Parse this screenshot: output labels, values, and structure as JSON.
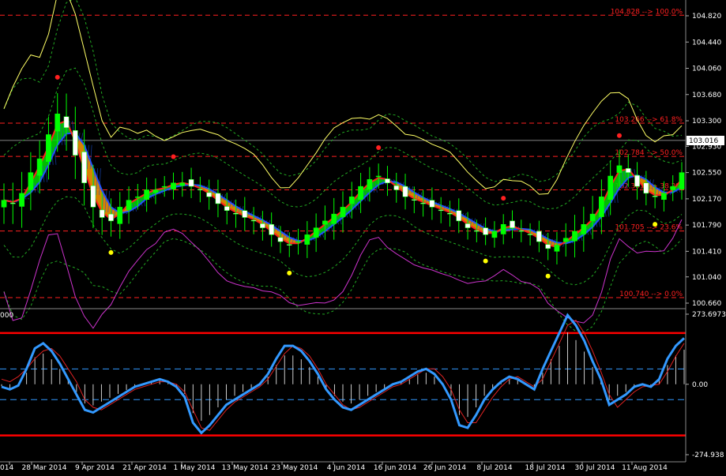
{
  "chart_data": [
    {
      "type": "candlestick",
      "ylim": [
        100.66,
        104.82
      ],
      "y_ticks": [
        "104.820",
        "104.440",
        "104.060",
        "103.680",
        "103.300",
        "102.930",
        "102.550",
        "102.170",
        "101.790",
        "101.410",
        "101.040",
        "100.660"
      ],
      "x_labels": [
        "014",
        "28 Mar 2014",
        "9 Apr 2014",
        "21 Apr 2014",
        "1 May 2014",
        "13 May 2014",
        "23 May 2014",
        "4 Jun 2014",
        "16 Jun 2014",
        "26 Jun 2014",
        "8 Jul 2014",
        "18 Jul 2014",
        "30 Jul 2014",
        "11 Aug 2014"
      ],
      "current_price": "103.016",
      "fib_levels": [
        {
          "value": 104.828,
          "label": "104.828 --> 100.0%"
        },
        {
          "value": 103.266,
          "label": "103.266 --> 61.8%"
        },
        {
          "value": 102.784,
          "label": "102.784 --> 50.0%"
        },
        {
          "value": 102.3,
          "label": "102.301 --> 38.2%"
        },
        {
          "value": 101.705,
          "label": "101.705 --> 23.6%"
        },
        {
          "value": 100.74,
          "label": "100.740 --> 0.0%"
        }
      ],
      "close_path": [
        102.15,
        102.1,
        102.25,
        102.55,
        102.75,
        103.1,
        103.4,
        103.2,
        102.8,
        102.4,
        102.05,
        101.9,
        101.85,
        102.05,
        102.15,
        102.2,
        102.3,
        102.3,
        102.35,
        102.4,
        102.4,
        102.35,
        102.3,
        102.2,
        102.1,
        102.0,
        101.95,
        101.9,
        101.85,
        101.75,
        101.65,
        101.55,
        101.5,
        101.55,
        101.65,
        101.75,
        101.85,
        101.95,
        102.05,
        102.2,
        102.35,
        102.45,
        102.5,
        102.4,
        102.3,
        102.2,
        102.15,
        102.1,
        102.05,
        102.0,
        101.95,
        101.85,
        101.75,
        101.7,
        101.65,
        101.7,
        101.8,
        101.75,
        101.7,
        101.65,
        101.55,
        101.45,
        101.5,
        101.6,
        101.7,
        101.8,
        101.95,
        102.2,
        102.5,
        102.65,
        102.55,
        102.35,
        102.25,
        102.2,
        102.25,
        102.35,
        102.55
      ]
    },
    {
      "type": "oscillator",
      "ylim": [
        -274.938,
        273.6973
      ],
      "y_ticks": [
        "273.6973",
        "0.00",
        "-274.938"
      ],
      "top_left_label": "000",
      "levels": [
        {
          "value": 200
        },
        {
          "value": 60
        },
        {
          "value": -60
        },
        {
          "value": -200
        }
      ],
      "values": [
        -10,
        -20,
        -5,
        60,
        140,
        160,
        130,
        80,
        20,
        -40,
        -100,
        -110,
        -90,
        -70,
        -50,
        -30,
        -10,
        0,
        10,
        20,
        10,
        -10,
        -50,
        -150,
        -190,
        -160,
        -120,
        -80,
        -60,
        -40,
        -20,
        0,
        40,
        100,
        150,
        150,
        130,
        90,
        40,
        -20,
        -60,
        -90,
        -100,
        -80,
        -60,
        -40,
        -20,
        0,
        10,
        30,
        50,
        60,
        40,
        0,
        -60,
        -160,
        -170,
        -120,
        -60,
        -20,
        10,
        30,
        20,
        0,
        -20,
        60,
        130,
        200,
        270,
        230,
        170,
        90,
        20,
        -80,
        -60,
        -40,
        -10,
        0,
        -10,
        20,
        100,
        150,
        180
      ],
      "signal": [
        20,
        10,
        30,
        60,
        100,
        130,
        140,
        110,
        60,
        10,
        -60,
        -90,
        -100,
        -80,
        -60,
        -40,
        -20,
        -10,
        0,
        10,
        10,
        0,
        -30,
        -100,
        -170,
        -180,
        -140,
        -100,
        -70,
        -50,
        -30,
        -10,
        20,
        70,
        120,
        150,
        140,
        110,
        60,
        0,
        -40,
        -80,
        -100,
        -90,
        -70,
        -50,
        -30,
        -10,
        0,
        20,
        40,
        60,
        60,
        30,
        -20,
        -100,
        -150,
        -150,
        -100,
        -50,
        -10,
        20,
        30,
        10,
        -10,
        20,
        90,
        160,
        230,
        250,
        200,
        130,
        50,
        -40,
        -90,
        -60,
        -30,
        -10,
        -5,
        0,
        50,
        110,
        160
      ]
    }
  ],
  "colors": {
    "background": "#000000",
    "up_candle": "#00ff00",
    "down_candle": "#ffffff",
    "wick": "#00ff00",
    "orange_band": "#ff9900",
    "green_band": "#00dd00",
    "blue_ma": "#2050ff",
    "red_ma": "#ff2020",
    "yellow_line": "#ffff66",
    "magenta_line": "#cc33cc",
    "bollinger": "#22aa22",
    "fib": "#ff2020",
    "osc_main": "#3399ff",
    "osc_signal": "#dd2222",
    "osc_level": "#ff0000",
    "axis_text": "#ffffff"
  }
}
